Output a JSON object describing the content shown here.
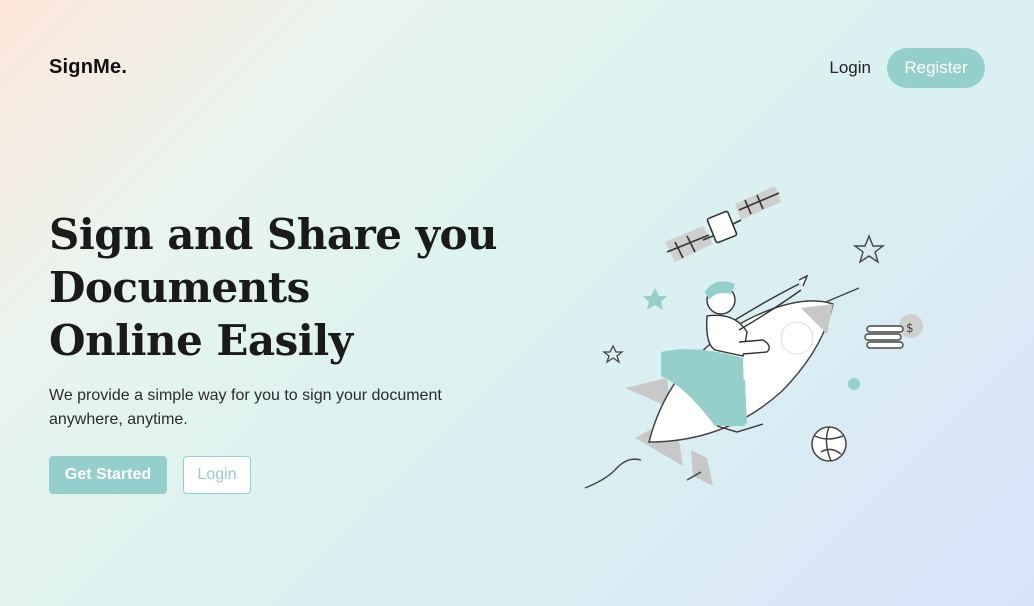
{
  "brand": {
    "name": "SignMe."
  },
  "nav": {
    "login_label": "Login",
    "register_label": "Register"
  },
  "hero": {
    "title_lines": [
      "Sign and Share you",
      "Documents",
      "Online Easily"
    ],
    "subtitle": "We provide a simple way for you to sign your document anywhere, anytime.",
    "primary_cta": "Get Started",
    "secondary_cta": "Login"
  },
  "colors": {
    "accent": "#95cfcb",
    "text": "#1a1a1a",
    "illustration_grey": "#c8c8c8"
  },
  "icons": [
    "rocket-illustration",
    "satellite-icon",
    "star-icon",
    "planet-icon",
    "coin-stack-icon"
  ]
}
